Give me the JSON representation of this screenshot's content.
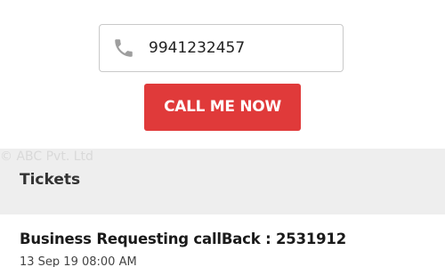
{
  "callback_form": {
    "phone_value": "9941232457",
    "phone_icon": "phone-icon",
    "button_label": "CALL ME NOW",
    "button_color": "#e03a3a"
  },
  "watermark": "© ABC Pvt. Ltd",
  "tickets": {
    "header": "Tickets",
    "items": [
      {
        "title": "Business Requesting callBack : 2531912",
        "datetime": "13 Sep 19 08:00 AM"
      }
    ]
  },
  "colors": {
    "band_background": "#eeeeee",
    "text_primary": "#1a1a1a"
  }
}
